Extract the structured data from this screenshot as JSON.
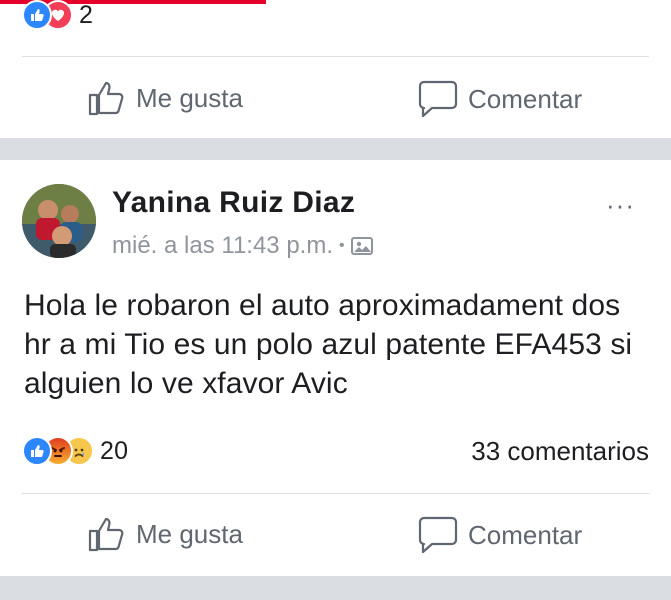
{
  "top_post": {
    "reaction_count": "2",
    "reactions": [
      "like-icon",
      "love-icon"
    ],
    "like_label": "Me gusta",
    "comment_label": "Comentar"
  },
  "post": {
    "author": "Yanina Ruiz Diaz",
    "timestamp": "mié. a las 11:43 p.m.",
    "separator": "•",
    "privacy_icon": "photo-icon",
    "more_label": "···",
    "text": "Hola le robaron el auto aproximadament dos hr a mi Tio es un polo azul patente EFA453 si alguien lo ve xfavor Avic",
    "reactions": [
      "like-icon",
      "angry-icon",
      "sad-icon"
    ],
    "reaction_count": "20",
    "comments_count": "33 comentarios",
    "like_label": "Me gusta",
    "comment_label": "Comentar"
  },
  "colors": {
    "like_blue": "#2d88ff",
    "love_red": "#f33e58",
    "action_gray": "#606770",
    "meta_gray": "#90949c",
    "divider": "#dddfe2",
    "separator_bg": "#dadde1"
  }
}
